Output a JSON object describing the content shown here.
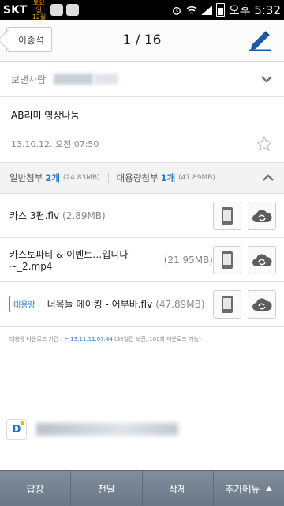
{
  "status": {
    "carrier": "SKT",
    "weather_top": "토요일",
    "weather_bottom": "12월",
    "time": "오후 5:32"
  },
  "header": {
    "back_label": "이종석",
    "pager": "1 / 16"
  },
  "sender": {
    "label": "보낸사람"
  },
  "mail": {
    "subject": "AB리미 영상나눔",
    "date": "13.10.12. 오전 07:50"
  },
  "attachments": {
    "normal_label": "일반첨부",
    "normal_count": "2개",
    "normal_size": "(24.83MB)",
    "large_label": "대용량첨부",
    "large_count": "1개",
    "large_size": "(47.89MB)",
    "files": [
      {
        "name": "카스 3편.flv",
        "size": "(2.89MB)",
        "badge": ""
      },
      {
        "name": "카스토파티 & 이벤트…입니다 ~_2.mp4",
        "size": "(21.95MB)",
        "badge": ""
      },
      {
        "name": "너목들 메이킹 - 어부바.flv",
        "size": "(47.89MB)",
        "badge": "대용량"
      }
    ]
  },
  "notice": {
    "prefix": "대용량 다운로드 기간 : ",
    "date": "~ 13.11.11.07:44",
    "suffix": " (30일간 보관, 100회 다운로드 가능)"
  },
  "toolbar": {
    "reply": "답장",
    "forward": "전달",
    "delete": "삭제",
    "more": "추가메뉴"
  },
  "colors": {
    "accent": "#1e7ad0",
    "toolbar": "#74828f"
  }
}
